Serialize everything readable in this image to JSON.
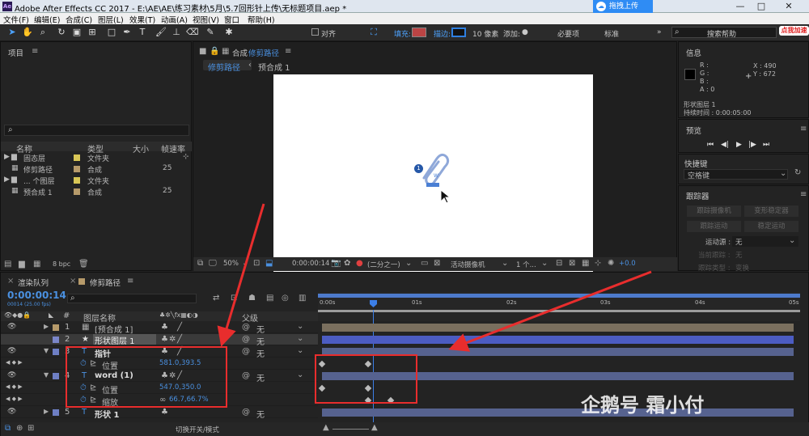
{
  "window": {
    "title": "Adobe After Effects CC 2017 - E:\\AE\\AE\\练习素材\\5月\\5.7回形针上传\\无标题项目.aep *",
    "logo": "Ae",
    "upload_button": "拖拽上传",
    "controls": [
      "—",
      "□",
      "✕"
    ]
  },
  "menu": [
    "文件(F)",
    "编辑(E)",
    "合成(C)",
    "图层(L)",
    "效果(T)",
    "动画(A)",
    "视图(V)",
    "窗口",
    "帮助(H)"
  ],
  "toolbar": {
    "align": "对齐",
    "fill": "填充:",
    "stroke": "描边:",
    "stroke_width": "10 像素",
    "add": "添加:",
    "workspace_essentials": "必要项",
    "workspace_standard": "标准",
    "search_placeholder": "搜索帮助",
    "badge_hot": "点我加速",
    "badge_num": "94"
  },
  "project": {
    "title": "项目",
    "search_glyph": "⌕",
    "columns": [
      "名称",
      "类型",
      "大小",
      "帧速率"
    ],
    "items": [
      {
        "name": "固态层",
        "type": "文件夹",
        "fps": "",
        "color": "#d8c656"
      },
      {
        "name": "修剪路径",
        "type": "合成",
        "fps": "25",
        "color": "#b69a6a"
      },
      {
        "name": "... 个图层",
        "type": "文件夹",
        "fps": "",
        "color": "#d8c656"
      },
      {
        "name": "预合成 1",
        "type": "合成",
        "fps": "25",
        "color": "#b69a6a"
      }
    ],
    "bpc": "8 bpc"
  },
  "composition": {
    "panel_label": "合成",
    "comp_name": "修剪路径",
    "tabs": [
      "修剪路径",
      "预合成 1"
    ],
    "zoom": "50%",
    "timecode": "0:00:00:14",
    "resolution": "(二分之一)",
    "camera": "活动摄像机",
    "views": "1 个...",
    "exposure": "+0.0",
    "badge": "1"
  },
  "info": {
    "title": "信息",
    "r": "R :",
    "g": "G :",
    "b": "B :",
    "a": "A : 0",
    "x": "X : 490",
    "y": "Y : 672",
    "layer": "形状图层 1",
    "duration": "持续时间 : 0:00:05:00"
  },
  "preview": {
    "title": "预览",
    "buttons": [
      "⏮",
      "◀|",
      "▶",
      "|▶",
      "⏭"
    ]
  },
  "shortcuts": {
    "title": "快捷键",
    "value": "空格键"
  },
  "tracker": {
    "title": "跟踪器",
    "buttons": [
      "跟踪摄像机",
      "变形稳定器",
      "跟踪运动",
      "稳定运动"
    ],
    "source_label": "运动源 :",
    "source_value": "无",
    "current_label": "当前跟踪 :",
    "current_value": "无",
    "type_label": "跟踪类型 :",
    "type_value": "变换"
  },
  "timeline": {
    "tabs": [
      "渲染队列",
      "修剪路径"
    ],
    "timecode": "0:00:00:14",
    "timecode_sub": "00014 (25.00 fps)",
    "columns": {
      "num": "#",
      "name": "图层名称",
      "parent": "父级"
    },
    "ruler": [
      "0:00s",
      "01s",
      "02s",
      "03s",
      "04s",
      "05s"
    ],
    "footer": "切换开关/模式",
    "layers": [
      {
        "num": "1",
        "name": "[预合成 1]",
        "color": "#b69a6a",
        "parent": "无",
        "kind": "layer"
      },
      {
        "num": "2",
        "name": "形状图层 1",
        "color": "#7b86c8",
        "parent": "无",
        "kind": "layer-selected"
      },
      {
        "num": "3",
        "name": "指针",
        "color": "#6e7fc4",
        "parent": "无",
        "kind": "layer"
      },
      {
        "num": "",
        "name": "位置",
        "value": "581.0,393.5",
        "kind": "prop"
      },
      {
        "num": "4",
        "name": "word (1)",
        "color": "#6e7fc4",
        "parent": "无",
        "kind": "layer"
      },
      {
        "num": "",
        "name": "位置",
        "value": "547.0,350.0",
        "kind": "prop"
      },
      {
        "num": "",
        "name": "缩放",
        "value": "66.7,66.7%",
        "kind": "prop"
      },
      {
        "num": "5",
        "name": "形状 1",
        "color": "#6e7fc4",
        "parent": "无",
        "kind": "layer"
      }
    ]
  },
  "watermark": {
    "text": "企鹅号 霜小付"
  }
}
